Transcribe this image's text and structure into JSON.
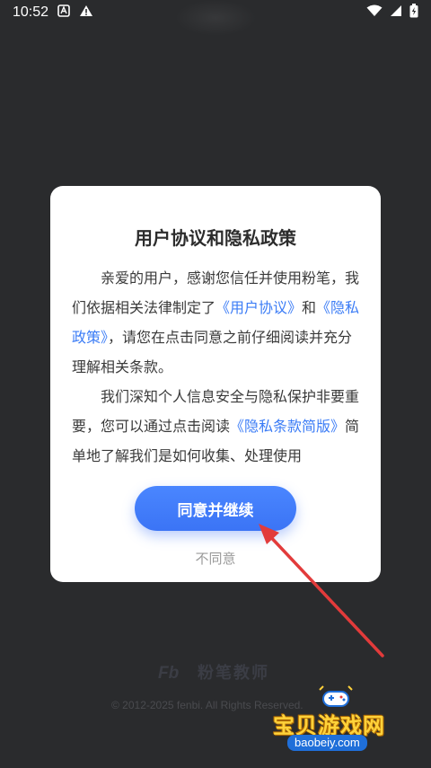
{
  "status_bar": {
    "time": "10:52"
  },
  "dialog": {
    "title": "用户协议和隐私政策",
    "p1_text1": "亲爱的用户，感谢您信任并使用粉笔，我们依据相关法律制定了",
    "p1_link1": "《用户协议》",
    "p1_text2": "和",
    "p1_link2": "《隐私政策》",
    "p1_text3": "，请您在点击同意之前仔细阅读并充分理解相关条款。",
    "p2_text1": "我们深知个人信息安全与隐私保护非要重要，您可以通过点击阅读",
    "p2_link1": "《隐私条款简版》",
    "p2_text2": "简单地了解我们是如何收集、处理使用",
    "agree_label": "同意并继续",
    "disagree_label": "不同意"
  },
  "brand": {
    "logo_text": "Fb",
    "name": "粉笔教师",
    "copyright": "© 2012-2025 fenbi. All Rights Reserved."
  },
  "watermark": {
    "text": "宝贝游戏网",
    "url": "baobeiy.com"
  },
  "colors": {
    "accent": "#3b7cf6",
    "background": "#2a2b2d",
    "arrow": "#e23b3b"
  }
}
